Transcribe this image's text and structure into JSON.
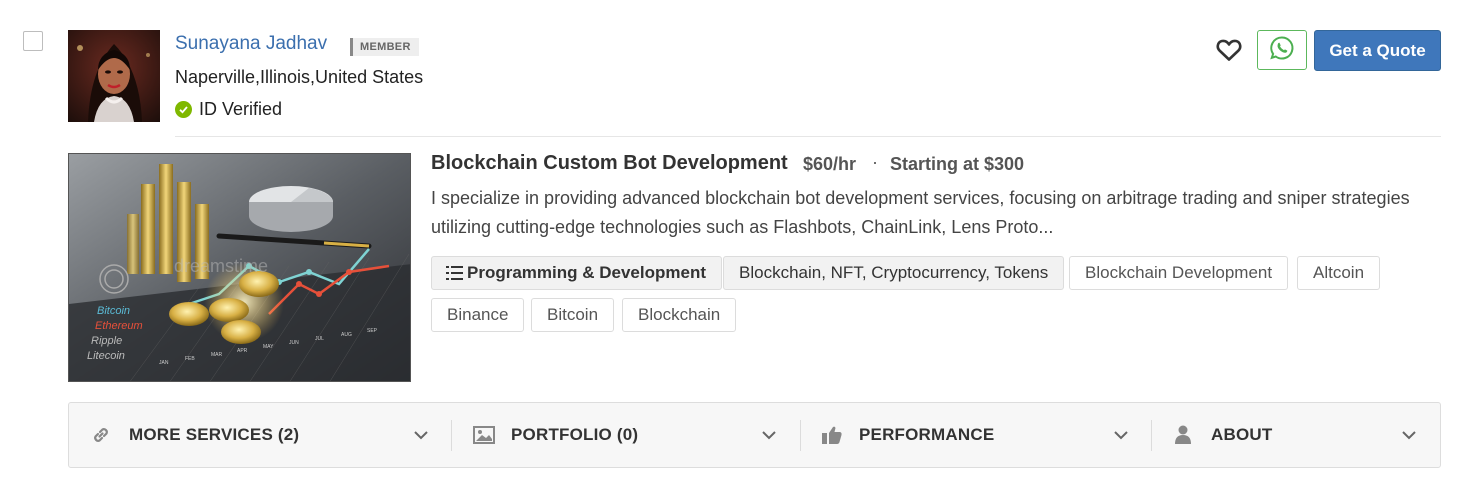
{
  "profile": {
    "name": "Sunayana Jadhav",
    "badge": "MEMBER",
    "location": "Naperville,Illinois,United States",
    "verified": "ID Verified"
  },
  "actions": {
    "favorite_icon": "heart-icon",
    "whatsapp_icon": "whatsapp-icon",
    "quote_label": "Get a Quote"
  },
  "service": {
    "title": "Blockchain Custom Bot Development",
    "rate": "$60/hr",
    "separator": "·",
    "starting": "Starting at $300",
    "description": "I specialize in providing advanced blockchain bot development services, focusing on arbitrage trading and sniper strategies utilizing cutting-edge technologies such as Flashbots, ChainLink, Lens Proto..."
  },
  "image_labels": {
    "watermark": "dreamstime",
    "coins": [
      "Bitcoin",
      "Ethereum",
      "Ripple",
      "Litecoin"
    ],
    "months": [
      "JAN",
      "FEB",
      "MAR",
      "APR",
      "MAY",
      "JUN",
      "JUL",
      "AUG",
      "SEP"
    ]
  },
  "tags": {
    "category": "Programming & Development",
    "subcategory": "Blockchain, NFT, Cryptocurrency, Tokens",
    "skills": [
      "Blockchain Development",
      "Altcoin",
      "Binance",
      "Bitcoin",
      "Blockchain"
    ]
  },
  "bottom_bar": {
    "more_services": "MORE SERVICES (2)",
    "portfolio": "PORTFOLIO (0)",
    "performance": "PERFORMANCE",
    "about": "ABOUT"
  },
  "colors": {
    "link_blue": "#3b6fae",
    "quote_button": "#3f77bb",
    "whatsapp_green": "#5cb85c",
    "verified_green": "#7fb800"
  }
}
